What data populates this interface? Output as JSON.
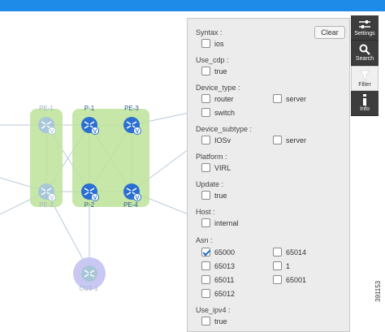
{
  "topology": {
    "nodes": [
      {
        "label": "PE-1",
        "faded": true
      },
      {
        "label": "P-1",
        "faded": false
      },
      {
        "label": "PE-3",
        "faded": false
      },
      {
        "label": "PE-2",
        "faded": true
      },
      {
        "label": "P-2",
        "faded": false
      },
      {
        "label": "PE-4",
        "faded": false
      },
      {
        "label": "CU1-1",
        "faded": true
      }
    ],
    "node_icon": "router-icon",
    "badge_letter": "V",
    "colors": {
      "group_fill": "#bde39a",
      "router_blue": "#2a6fd1",
      "router_faded": "#a8c6d8",
      "customer_fill": "#c9c8f2",
      "link": "#b8cad8"
    }
  },
  "filter_panel": {
    "clear_label": "Clear",
    "sections": [
      {
        "title": "Syntax :",
        "options": [
          {
            "label": "ios",
            "checked": false
          }
        ]
      },
      {
        "title": "Use_cdp :",
        "options": [
          {
            "label": "true",
            "checked": false
          }
        ]
      },
      {
        "title": "Device_type :",
        "options": [
          {
            "label": "router",
            "checked": false
          },
          {
            "label": "server",
            "checked": false
          },
          {
            "label": "switch",
            "checked": false
          }
        ]
      },
      {
        "title": "Device_subtype :",
        "options": [
          {
            "label": "IOSv",
            "checked": false
          },
          {
            "label": "server",
            "checked": false
          }
        ]
      },
      {
        "title": "Platform :",
        "options": [
          {
            "label": "VIRL",
            "checked": false
          }
        ]
      },
      {
        "title": "Update :",
        "options": [
          {
            "label": "true",
            "checked": false
          }
        ]
      },
      {
        "title": "Host :",
        "options": [
          {
            "label": "internal",
            "checked": false
          }
        ]
      },
      {
        "title": "Asn :",
        "options": [
          {
            "label": "65000",
            "checked": true
          },
          {
            "label": "65014",
            "checked": false
          },
          {
            "label": "65013",
            "checked": false
          },
          {
            "label": "1",
            "checked": false
          },
          {
            "label": "65011",
            "checked": false
          },
          {
            "label": "65001",
            "checked": false
          },
          {
            "label": "65012",
            "checked": false
          }
        ]
      },
      {
        "title": "Use_ipv4 :",
        "options": [
          {
            "label": "true",
            "checked": false
          }
        ]
      }
    ]
  },
  "toolbar": {
    "items": [
      {
        "label": "Settings",
        "icon": "sliders-icon",
        "active": false
      },
      {
        "label": "Search",
        "icon": "search-icon",
        "active": false
      },
      {
        "label": "Filter",
        "icon": "filter-icon",
        "active": true
      },
      {
        "label": "Info",
        "icon": "info-icon",
        "active": false
      }
    ]
  },
  "figure_id": "391153"
}
